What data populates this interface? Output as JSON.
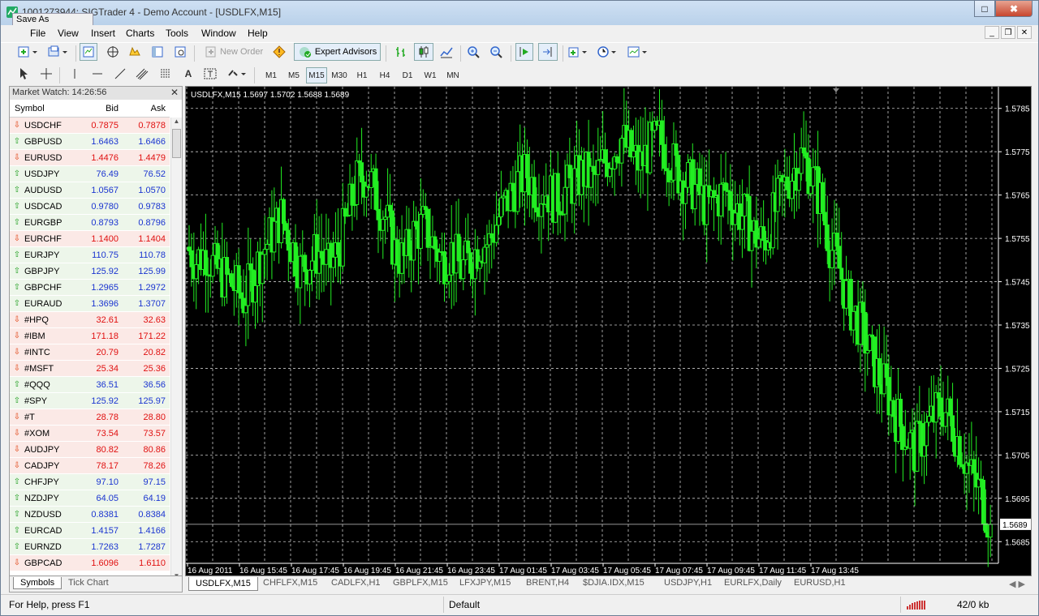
{
  "window": {
    "title": "1001273944: SIGTrader 4 - Demo Account - [USDLFX,M15]",
    "saveas": "Save As",
    "close": "✖",
    "max": "□"
  },
  "menu": [
    "File",
    "View",
    "Insert",
    "Charts",
    "Tools",
    "Window",
    "Help"
  ],
  "toolbar": {
    "new_order": "New Order",
    "expert_advisors": "Expert Advisors"
  },
  "timeframes": [
    "M1",
    "M5",
    "M15",
    "M30",
    "H1",
    "H4",
    "D1",
    "W1",
    "MN"
  ],
  "active_timeframe": "M15",
  "market_watch": {
    "title": "Market Watch: 14:26:56",
    "cols": {
      "symbol": "Symbol",
      "bid": "Bid",
      "ask": "Ask"
    },
    "rows": [
      {
        "s": "USDCHF",
        "b": "0.7875",
        "a": "0.7878",
        "d": "dn"
      },
      {
        "s": "GBPUSD",
        "b": "1.6463",
        "a": "1.6466",
        "d": "up"
      },
      {
        "s": "EURUSD",
        "b": "1.4476",
        "a": "1.4479",
        "d": "dn"
      },
      {
        "s": "USDJPY",
        "b": "76.49",
        "a": "76.52",
        "d": "up"
      },
      {
        "s": "AUDUSD",
        "b": "1.0567",
        "a": "1.0570",
        "d": "up"
      },
      {
        "s": "USDCAD",
        "b": "0.9780",
        "a": "0.9783",
        "d": "up"
      },
      {
        "s": "EURGBP",
        "b": "0.8793",
        "a": "0.8796",
        "d": "up"
      },
      {
        "s": "EURCHF",
        "b": "1.1400",
        "a": "1.1404",
        "d": "dn"
      },
      {
        "s": "EURJPY",
        "b": "110.75",
        "a": "110.78",
        "d": "up"
      },
      {
        "s": "GBPJPY",
        "b": "125.92",
        "a": "125.99",
        "d": "up"
      },
      {
        "s": "GBPCHF",
        "b": "1.2965",
        "a": "1.2972",
        "d": "up"
      },
      {
        "s": "EURAUD",
        "b": "1.3696",
        "a": "1.3707",
        "d": "up"
      },
      {
        "s": "#HPQ",
        "b": "32.61",
        "a": "32.63",
        "d": "dn"
      },
      {
        "s": "#IBM",
        "b": "171.18",
        "a": "171.22",
        "d": "dn"
      },
      {
        "s": "#INTC",
        "b": "20.79",
        "a": "20.82",
        "d": "dn"
      },
      {
        "s": "#MSFT",
        "b": "25.34",
        "a": "25.36",
        "d": "dn"
      },
      {
        "s": "#QQQ",
        "b": "36.51",
        "a": "36.56",
        "d": "up"
      },
      {
        "s": "#SPY",
        "b": "125.92",
        "a": "125.97",
        "d": "up"
      },
      {
        "s": "#T",
        "b": "28.78",
        "a": "28.80",
        "d": "dn"
      },
      {
        "s": "#XOM",
        "b": "73.54",
        "a": "73.57",
        "d": "dn"
      },
      {
        "s": "AUDJPY",
        "b": "80.82",
        "a": "80.86",
        "d": "dn"
      },
      {
        "s": "CADJPY",
        "b": "78.17",
        "a": "78.26",
        "d": "dn"
      },
      {
        "s": "CHFJPY",
        "b": "97.10",
        "a": "97.15",
        "d": "up"
      },
      {
        "s": "NZDJPY",
        "b": "64.05",
        "a": "64.19",
        "d": "up"
      },
      {
        "s": "NZDUSD",
        "b": "0.8381",
        "a": "0.8384",
        "d": "up"
      },
      {
        "s": "EURCAD",
        "b": "1.4157",
        "a": "1.4166",
        "d": "up"
      },
      {
        "s": "EURNZD",
        "b": "1.7263",
        "a": "1.7287",
        "d": "up"
      },
      {
        "s": "GBPCAD",
        "b": "1.6096",
        "a": "1.6110",
        "d": "dn"
      }
    ],
    "tabs": {
      "symbols": "Symbols",
      "tick": "Tick Chart"
    }
  },
  "chart_tabs": [
    "USDLFX,M15",
    "CHFLFX,M15",
    "CADLFX,H1",
    "GBPLFX,M15",
    "LFXJPY,M15",
    "BRENT,H4",
    "$DJIA.IDX,M15",
    "USDJPY,H1",
    "EURLFX,Daily",
    "EURUSD,H1"
  ],
  "status": {
    "help": "For Help, press F1",
    "profile": "Default",
    "traffic": "42/0 kb"
  },
  "colors": {
    "candle": "#22ee22",
    "grid": "#c8c8c8",
    "bg": "#000000",
    "axis": "#ffffff"
  },
  "chart_data": {
    "type": "candlestick",
    "symbol_label": "USDLFX,M15  1.5697 1.5702 1.5688 1.5689",
    "last_price_label": "1.5689",
    "last_price": 1.5689,
    "ylim": [
      1.568,
      1.579
    ],
    "yticks": [
      1.5785,
      1.5775,
      1.5765,
      1.5755,
      1.5745,
      1.5735,
      1.5725,
      1.5715,
      1.5705,
      1.5695,
      1.5685
    ],
    "ytick_labels": [
      "1.5785",
      "1.5775",
      "1.5765",
      "1.5755",
      "1.5745",
      "1.5735",
      "1.5725",
      "1.5715",
      "1.5705",
      "1.5695",
      "1.5685"
    ],
    "xtick_labels": [
      "16 Aug 2011",
      "16 Aug 15:45",
      "16 Aug 17:45",
      "16 Aug 19:45",
      "16 Aug 21:45",
      "16 Aug 23:45",
      "17 Aug 01:45",
      "17 Aug 03:45",
      "17 Aug 05:45",
      "17 Aug 07:45",
      "17 Aug 09:45",
      "17 Aug 11:45",
      "17 Aug 13:45"
    ],
    "close_trend": [
      1.5753,
      1.575,
      1.5752,
      1.5748,
      1.5746,
      1.5744,
      1.5741,
      1.5746,
      1.5752,
      1.5756,
      1.576,
      1.5754,
      1.5748,
      1.575,
      1.5752,
      1.5748,
      1.5752,
      1.576,
      1.5768,
      1.577,
      1.5765,
      1.576,
      1.5752,
      1.575,
      1.5756,
      1.5758,
      1.5754,
      1.575,
      1.5752,
      1.5748,
      1.575,
      1.5754,
      1.5754,
      1.576,
      1.5764,
      1.5768,
      1.577,
      1.5766,
      1.5766,
      1.5764,
      1.5766,
      1.5768,
      1.577,
      1.5768,
      1.5772,
      1.5775,
      1.5778,
      1.5774,
      1.5772,
      1.5776,
      1.5778,
      1.5774,
      1.577,
      1.5768,
      1.5766,
      1.5762,
      1.5764,
      1.5766,
      1.5762,
      1.576,
      1.5756,
      1.5754,
      1.576,
      1.5766,
      1.577,
      1.5774,
      1.577,
      1.5764,
      1.5754,
      1.5748,
      1.574,
      1.5736,
      1.573,
      1.5724,
      1.572,
      1.5714,
      1.571,
      1.5706,
      1.571,
      1.5714,
      1.5716,
      1.5712,
      1.5706,
      1.57,
      1.5696,
      1.5689
    ]
  }
}
